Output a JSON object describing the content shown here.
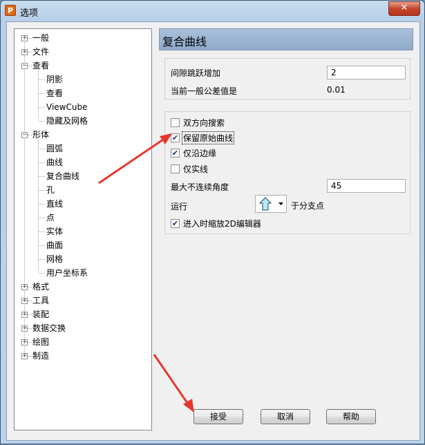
{
  "window": {
    "title": "选项",
    "app_icon_letter": "P",
    "close_label": "✕"
  },
  "tree": {
    "items": [
      {
        "label": "一般",
        "expander": "+"
      },
      {
        "label": "文件",
        "expander": "+"
      },
      {
        "label": "查看",
        "expander": "−"
      },
      {
        "label": "阴影"
      },
      {
        "label": "查看"
      },
      {
        "label": "ViewCube"
      },
      {
        "label": "隐藏及网格"
      },
      {
        "label": "形体",
        "expander": "−"
      },
      {
        "label": "圆弧"
      },
      {
        "label": "曲线"
      },
      {
        "label": "复合曲线"
      },
      {
        "label": "孔"
      },
      {
        "label": "直线"
      },
      {
        "label": "点"
      },
      {
        "label": "实体"
      },
      {
        "label": "曲面"
      },
      {
        "label": "网格"
      },
      {
        "label": "用户坐标系"
      },
      {
        "label": "格式",
        "expander": "+"
      },
      {
        "label": "工具",
        "expander": "+"
      },
      {
        "label": "装配",
        "expander": "+"
      },
      {
        "label": "数据交换",
        "expander": "+"
      },
      {
        "label": "绘图",
        "expander": "+"
      },
      {
        "label": "制造",
        "expander": "+"
      }
    ]
  },
  "panel": {
    "title": "复合曲线",
    "gap_increment_label": "间隙跳跃增加",
    "gap_increment_value": "2",
    "tolerance_label": "当前一般公差值是",
    "tolerance_value": "0.01",
    "checkboxes": [
      {
        "label": "双方向搜索",
        "checked": false
      },
      {
        "label": "保留原始曲线",
        "checked": true
      },
      {
        "label": "仅沿边缘",
        "checked": true
      },
      {
        "label": "仅实线",
        "checked": false
      }
    ],
    "max_angle_label": "最大不连续角度",
    "max_angle_value": "45",
    "run_label": "运行",
    "run_suffix": "于分支点",
    "zoom_2d_label": "进入时缩放2D编辑器",
    "zoom_2d_checked": true
  },
  "buttons": {
    "accept": "接受",
    "cancel": "取消",
    "help": "帮助"
  },
  "colors": {
    "annotation_arrow": "#e8362d"
  }
}
